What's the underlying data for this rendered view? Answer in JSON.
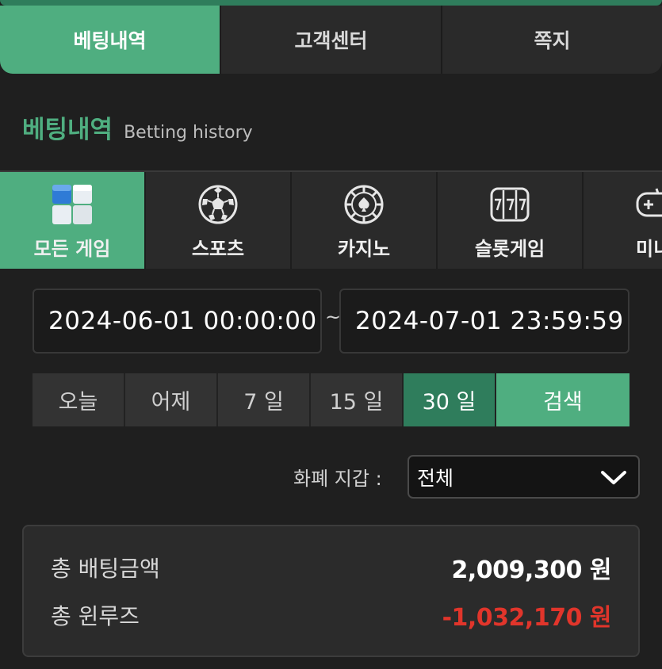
{
  "tabs": [
    {
      "label": "베팅내역"
    },
    {
      "label": "고객센터"
    },
    {
      "label": "쪽지"
    }
  ],
  "section": {
    "title_ko": "베팅내역",
    "title_en": "Betting history"
  },
  "categories": [
    {
      "label": "모든 게임",
      "icon": "all-games-icon"
    },
    {
      "label": "스포츠",
      "icon": "soccer-ball-icon"
    },
    {
      "label": "카지노",
      "icon": "casino-chip-icon"
    },
    {
      "label": "슬롯게임",
      "icon": "slot-777-icon"
    },
    {
      "label": "미니",
      "icon": "gamepad-icon"
    }
  ],
  "date_range": {
    "start": "2024-06-01 00:00:00",
    "separator": "~",
    "end": "2024-07-01 23:59:59"
  },
  "ranges": [
    {
      "label": "오늘"
    },
    {
      "label": "어제"
    },
    {
      "label": "7 일"
    },
    {
      "label": "15 일"
    },
    {
      "label": "30 일"
    }
  ],
  "selected_range": "30 일",
  "search_label": "검색",
  "wallet": {
    "label": "화폐 지갑 :",
    "selected": "전체"
  },
  "summary": {
    "total_bet_label": "총 배팅금액",
    "total_bet_value": "2,009,300 원",
    "total_winloss_label": "총 윈루즈",
    "total_winloss_value": "-1,032,170 원"
  },
  "colors": {
    "accent": "#4fae80",
    "accent_dark": "#2f7d5c",
    "negative": "#e1352b",
    "background": "#1f1f1f"
  }
}
